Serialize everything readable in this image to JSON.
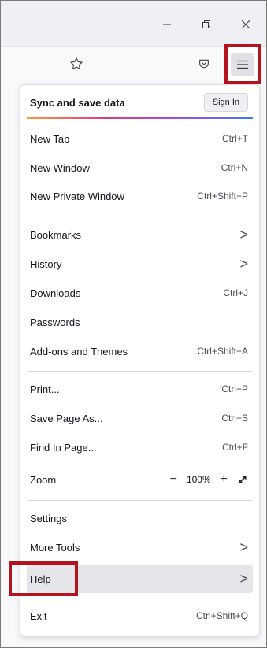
{
  "window": {
    "minimize_icon": "minimize-icon",
    "restore_icon": "restore-icon",
    "close_icon": "close-icon"
  },
  "toolbar": {
    "bookmark_star_icon": "star-icon",
    "pocket_icon": "pocket-icon",
    "menu_icon": "hamburger-menu-icon"
  },
  "menu": {
    "sync_label": "Sync and save data",
    "sign_in_label": "Sign In",
    "items": [
      {
        "label": "New Tab",
        "accel": "Ctrl+T"
      },
      {
        "label": "New Window",
        "accel": "Ctrl+N"
      },
      {
        "label": "New Private Window",
        "accel": "Ctrl+Shift+P"
      },
      {
        "label": "Bookmarks",
        "accel": ">"
      },
      {
        "label": "History",
        "accel": ">"
      },
      {
        "label": "Downloads",
        "accel": "Ctrl+J"
      },
      {
        "label": "Passwords",
        "accel": ""
      },
      {
        "label": "Add-ons and Themes",
        "accel": "Ctrl+Shift+A"
      },
      {
        "label": "Print...",
        "accel": "Ctrl+P"
      },
      {
        "label": "Save Page As...",
        "accel": "Ctrl+S"
      },
      {
        "label": "Find In Page...",
        "accel": "Ctrl+F"
      },
      {
        "label": "Settings",
        "accel": ""
      },
      {
        "label": "More Tools",
        "accel": ">"
      },
      {
        "label": "Help",
        "accel": ">"
      },
      {
        "label": "Exit",
        "accel": "Ctrl+Shift+Q"
      }
    ],
    "zoom": {
      "label": "Zoom",
      "minus": "−",
      "value": "100%",
      "plus": "+",
      "fullscreen_icon": "fullscreen-icon"
    }
  },
  "colors": {
    "highlight": "#b3141d",
    "hover_bg": "#e6e6ea"
  }
}
